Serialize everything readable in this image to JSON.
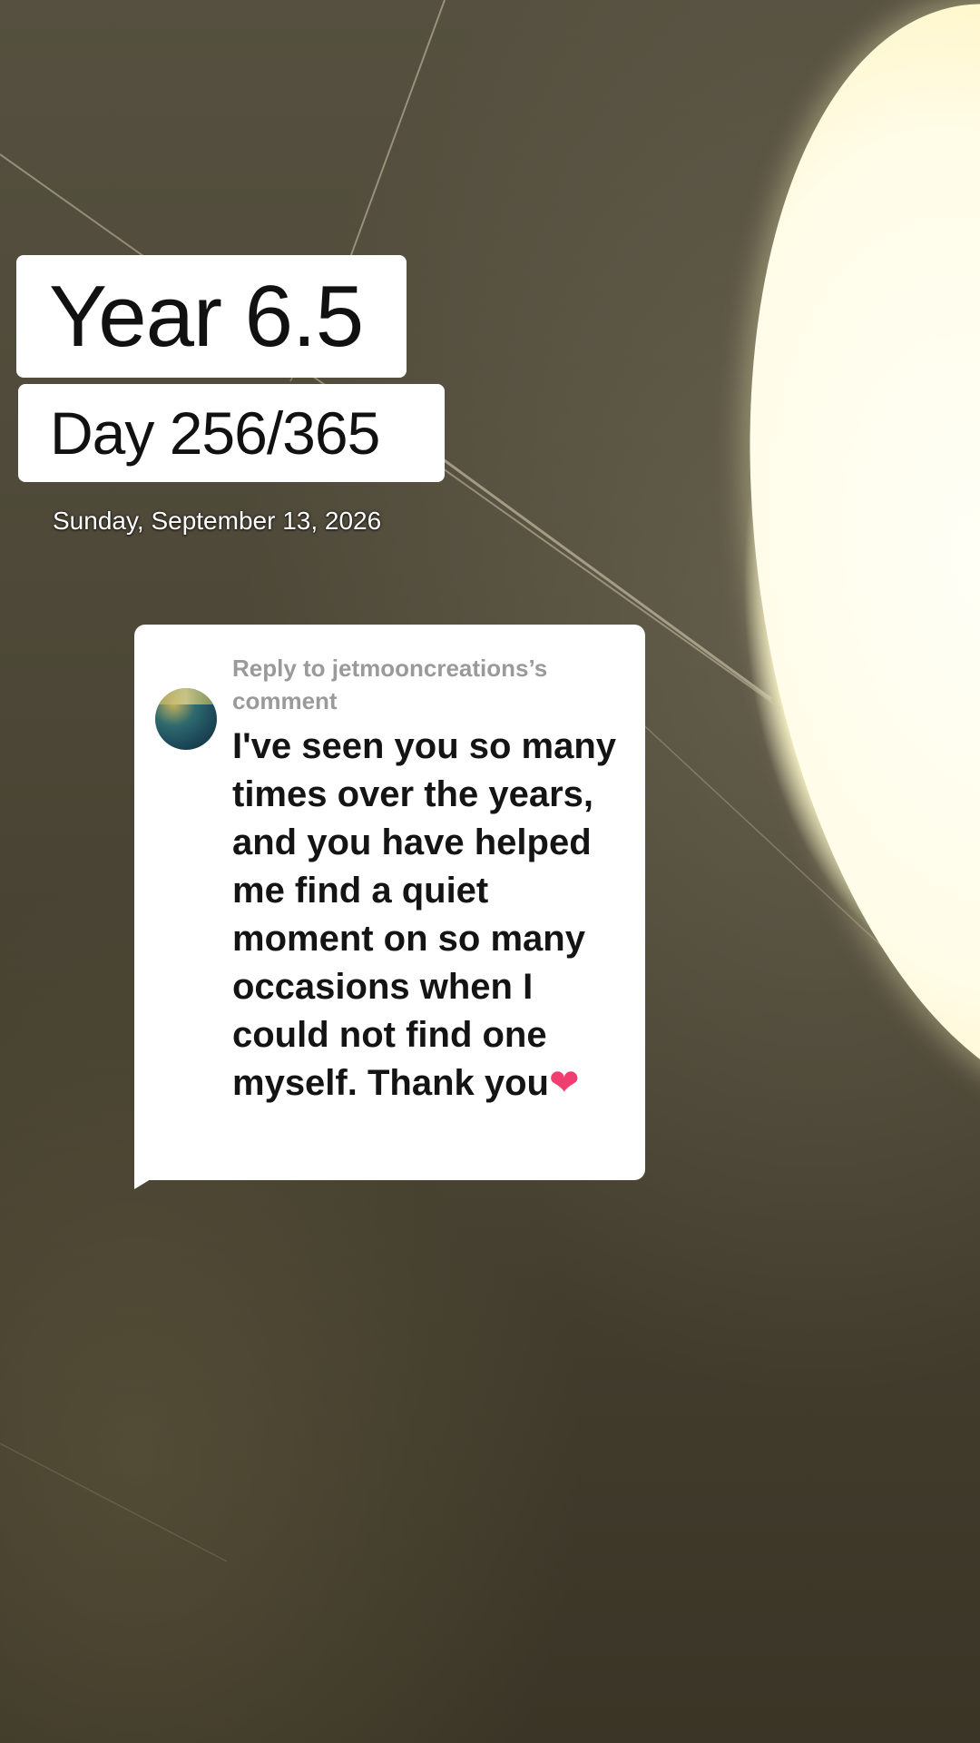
{
  "overlay": {
    "year_label": "Year 6.5",
    "day_label": "Day 256/365",
    "date_label": "Sunday, September 13, 2026"
  },
  "reply": {
    "header": "Reply to jetmooncreations’s comment",
    "body": "I've seen you so many times over the years, and you have helped me find a quiet moment on so many occasions when I could not find one myself. Thank you",
    "heart": "❤"
  },
  "colors": {
    "background": "#4c4736",
    "moon": "#fffce8",
    "card": "#ffffff",
    "header_text": "#9a9a9a",
    "body_text": "#141414",
    "heart": "#ef3e6f"
  },
  "icons": {
    "avatar": "user-avatar",
    "heart": "heart-icon"
  }
}
